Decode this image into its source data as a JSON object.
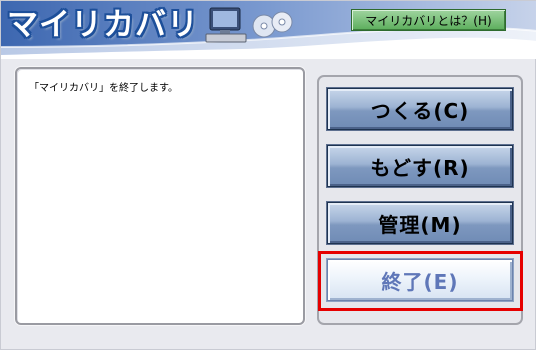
{
  "app": {
    "title": "マイリカバリ"
  },
  "header": {
    "help_button_label": "マイリカバリとは？(H)"
  },
  "message": {
    "text": "「マイリカバリ」を終了します。"
  },
  "actions": {
    "create_label": "つくる(C)",
    "restore_label": "もどす(R)",
    "manage_label": "管理(M)",
    "exit_label": "終了(E)"
  },
  "colors": {
    "brand_blue": "#1d4f9a",
    "action_button": "#9db3d3",
    "help_button": "#5cae5c",
    "highlight": "#e60000"
  },
  "icons": {
    "header_icon": "pc-with-discs-icon"
  }
}
